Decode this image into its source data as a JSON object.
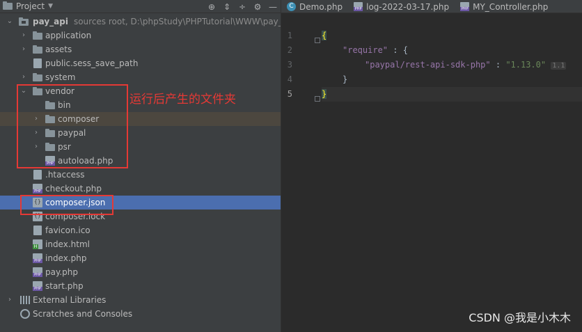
{
  "project_panel": {
    "title": "Project",
    "header_icons": [
      "crosshair-icon",
      "expand-all-icon",
      "collapse-all-icon",
      "gear-icon",
      "hide-icon"
    ],
    "tree": [
      {
        "label": "pay_api",
        "hint": "sources root,  D:\\phpStudy\\PHPTutorial\\WWW\\pay_a",
        "icon": "module-folder",
        "arrow": "down",
        "level": 0
      },
      {
        "label": "application",
        "icon": "folder",
        "arrow": "right",
        "level": 1
      },
      {
        "label": "assets",
        "icon": "folder",
        "arrow": "right",
        "level": 1
      },
      {
        "label": "public.sess_save_path",
        "icon": "file",
        "arrow": "",
        "level": 1
      },
      {
        "label": "system",
        "icon": "folder",
        "arrow": "right",
        "level": 1
      },
      {
        "label": "vendor",
        "icon": "folder",
        "arrow": "down",
        "level": 1
      },
      {
        "label": "bin",
        "icon": "folder",
        "arrow": "",
        "level": 2
      },
      {
        "label": "composer",
        "icon": "folder",
        "arrow": "right",
        "level": 2
      },
      {
        "label": "paypal",
        "icon": "folder",
        "arrow": "right",
        "level": 2
      },
      {
        "label": "psr",
        "icon": "folder",
        "arrow": "right",
        "level": 2
      },
      {
        "label": "autoload.php",
        "icon": "php",
        "arrow": "",
        "level": 2
      },
      {
        "label": ".htaccess",
        "icon": "file",
        "arrow": "",
        "level": 1
      },
      {
        "label": "checkout.php",
        "icon": "php",
        "arrow": "",
        "level": 1
      },
      {
        "label": "composer.json",
        "icon": "json",
        "arrow": "",
        "level": 1
      },
      {
        "label": "composer.lock",
        "icon": "file",
        "arrow": "",
        "level": 1
      },
      {
        "label": "favicon.ico",
        "icon": "file",
        "arrow": "",
        "level": 1
      },
      {
        "label": "index.html",
        "icon": "html",
        "arrow": "",
        "level": 1
      },
      {
        "label": "index.php",
        "icon": "php",
        "arrow": "",
        "level": 1
      },
      {
        "label": "pay.php",
        "icon": "php",
        "arrow": "",
        "level": 1
      },
      {
        "label": "start.php",
        "icon": "php",
        "arrow": "",
        "level": 1
      },
      {
        "label": "External Libraries",
        "icon": "libs",
        "arrow": "right",
        "level": 0
      },
      {
        "label": "Scratches and Consoles",
        "icon": "scratch",
        "arrow": "",
        "level": 0
      }
    ],
    "annotation": "运行后产生的文件夹"
  },
  "editor": {
    "tabs": [
      {
        "label": "Demo.php",
        "icon": "c"
      },
      {
        "label": "log-2022-03-17.php",
        "icon": "p"
      },
      {
        "label": "MY_Controller.php",
        "icon": "p"
      }
    ],
    "line_numbers": [
      "1",
      "2",
      "3",
      "4",
      "5"
    ],
    "code": {
      "l1_brace": "{",
      "l2_key": "\"require\"",
      "l2_rest": " : {",
      "l3_key": "\"paypal/rest-api-sdk-php\"",
      "l3_sep": " : ",
      "l3_val": "\"1.13.0\"",
      "l3_inlay": "1.1",
      "l4": "}",
      "l5_brace": "}"
    }
  },
  "watermark": "CSDN @我是小木木",
  "colors": {
    "selection": "#4b6eaf",
    "annotation": "#e53935",
    "panel_bg": "#3c3f41",
    "editor_bg": "#2b2b2b"
  }
}
